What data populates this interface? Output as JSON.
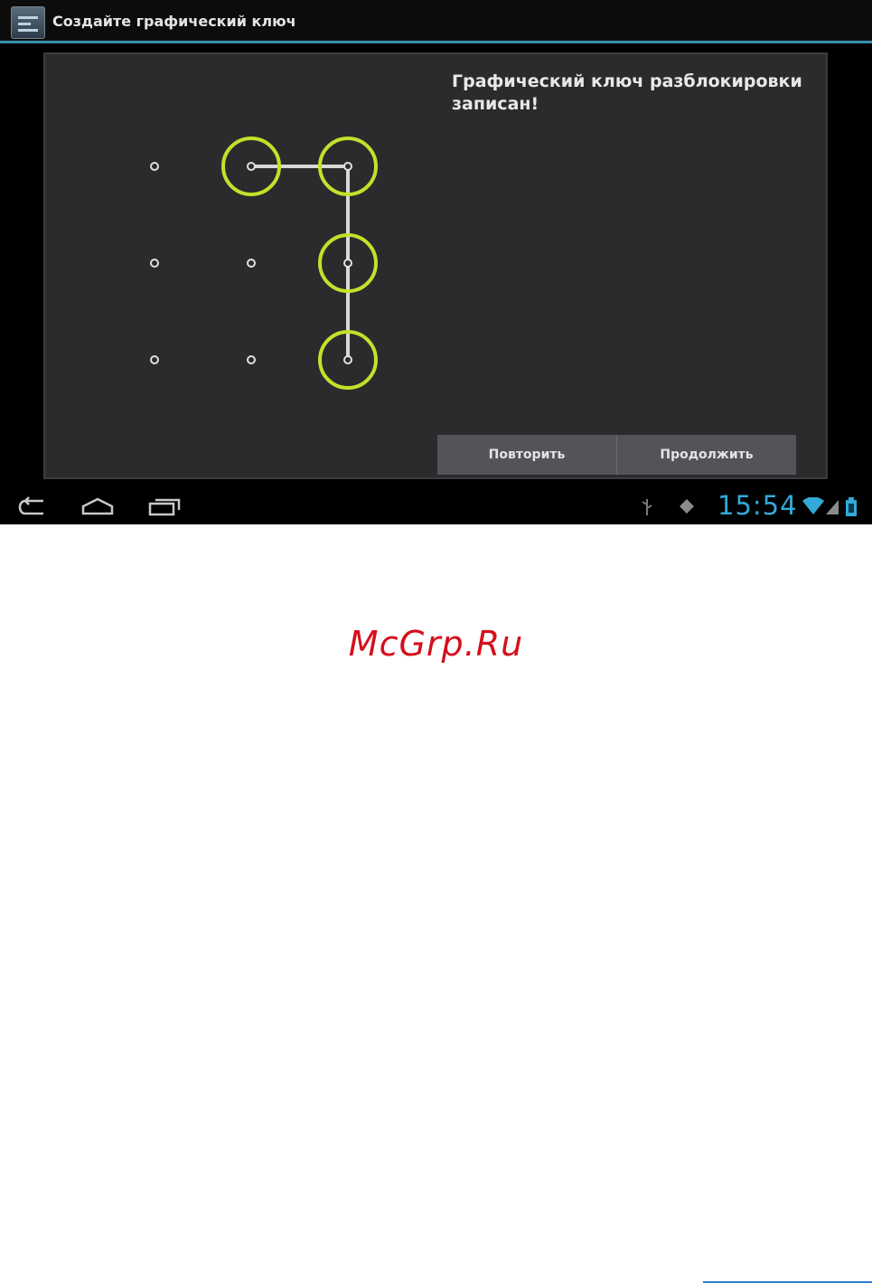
{
  "app": {
    "title": "Создайте графический ключ",
    "icon": "settings-app-icon"
  },
  "pattern": {
    "grid_size": 3,
    "selected_sequence": [
      1,
      2,
      5,
      8
    ],
    "ring_color": "#c5e02a",
    "line_color": "#d8d8d8"
  },
  "message": "Графический ключ разблокировки записан!",
  "buttons": {
    "retry": "Повторить",
    "continue": "Продолжить"
  },
  "navbar": {
    "back_icon": "back-icon",
    "home_icon": "home-icon",
    "recents_icon": "recent-apps-icon",
    "usb_icon": "usb-icon",
    "debug_icon": "android-debug-icon",
    "clock": "15:54",
    "wifi_icon": "wifi-icon",
    "signal_icon": "signal-icon",
    "battery_icon": "battery-icon",
    "accent_color": "#33a9d8"
  },
  "watermark": "McGrp.Ru"
}
